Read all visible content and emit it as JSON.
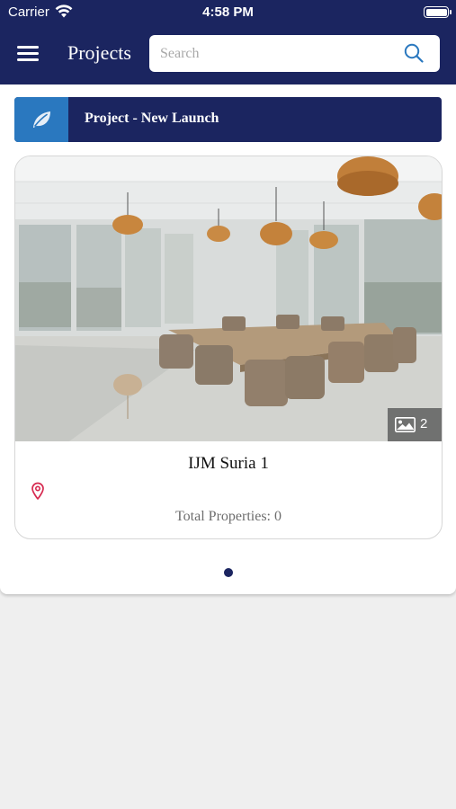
{
  "status_bar": {
    "carrier": "Carrier",
    "time": "4:58 PM"
  },
  "header": {
    "title": "Projects",
    "search_placeholder": "Search",
    "search_value": ""
  },
  "category": {
    "label": "Project - New Launch",
    "icon": "leaf-icon"
  },
  "project_card": {
    "name": "IJM Suria 1",
    "properties_text": "Total Properties: 0",
    "image_count": "2",
    "location_icon": "map-pin-icon"
  },
  "pagination": {
    "current": 1,
    "total": 1
  },
  "colors": {
    "nav_bg": "#1b2560",
    "accent_blue": "#2a78bf",
    "pin_red": "#d6294f",
    "page_bg": "#efefef"
  }
}
